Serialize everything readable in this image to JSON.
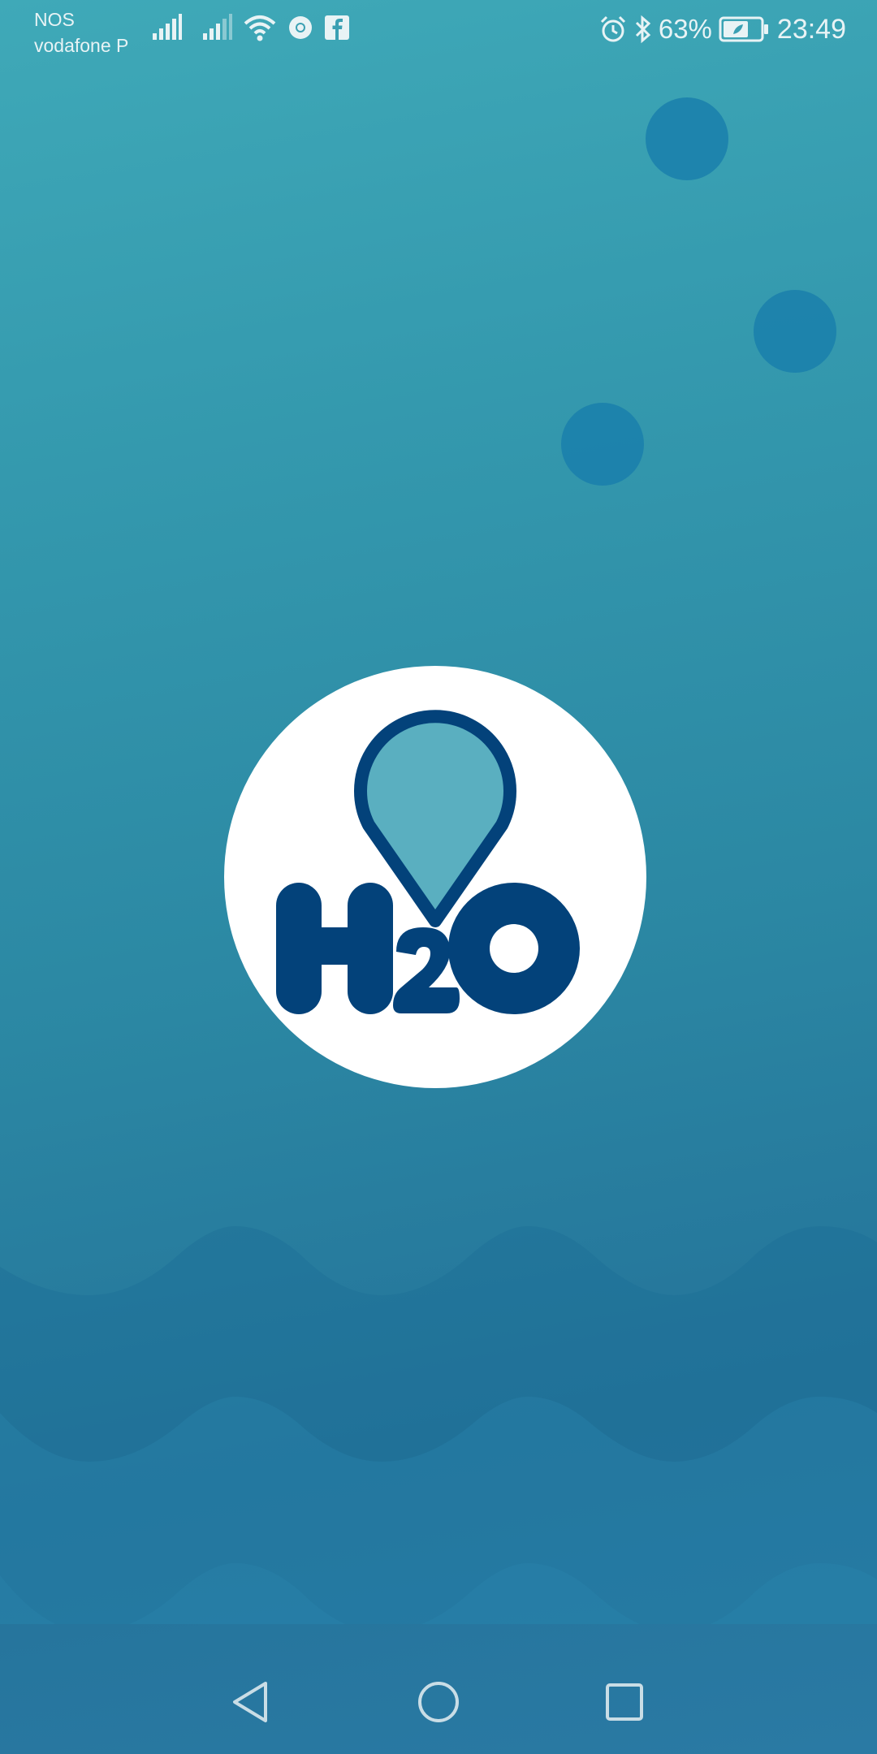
{
  "status_bar": {
    "carrier_primary": "NOS",
    "carrier_secondary": "vodafone P",
    "battery_percent": "63%",
    "time": "23:49",
    "icons_left": [
      "signal-icon",
      "signal-icon",
      "wifi-icon",
      "chrome-icon",
      "facebook-icon"
    ],
    "icons_right": [
      "alarm-icon",
      "bluetooth-icon",
      "battery-icon"
    ]
  },
  "app": {
    "logo_text": "H2O",
    "logo_colors": {
      "navy": "#03427a",
      "drop_fill": "#5aafc0",
      "circle": "#ffffff"
    }
  },
  "background": {
    "gradient_top": "#3fa9b8",
    "gradient_bottom": "#24739a",
    "bubble_color": "#1a7fab"
  },
  "nav_bar": {
    "buttons": [
      "back-icon",
      "home-icon",
      "recents-icon"
    ]
  }
}
